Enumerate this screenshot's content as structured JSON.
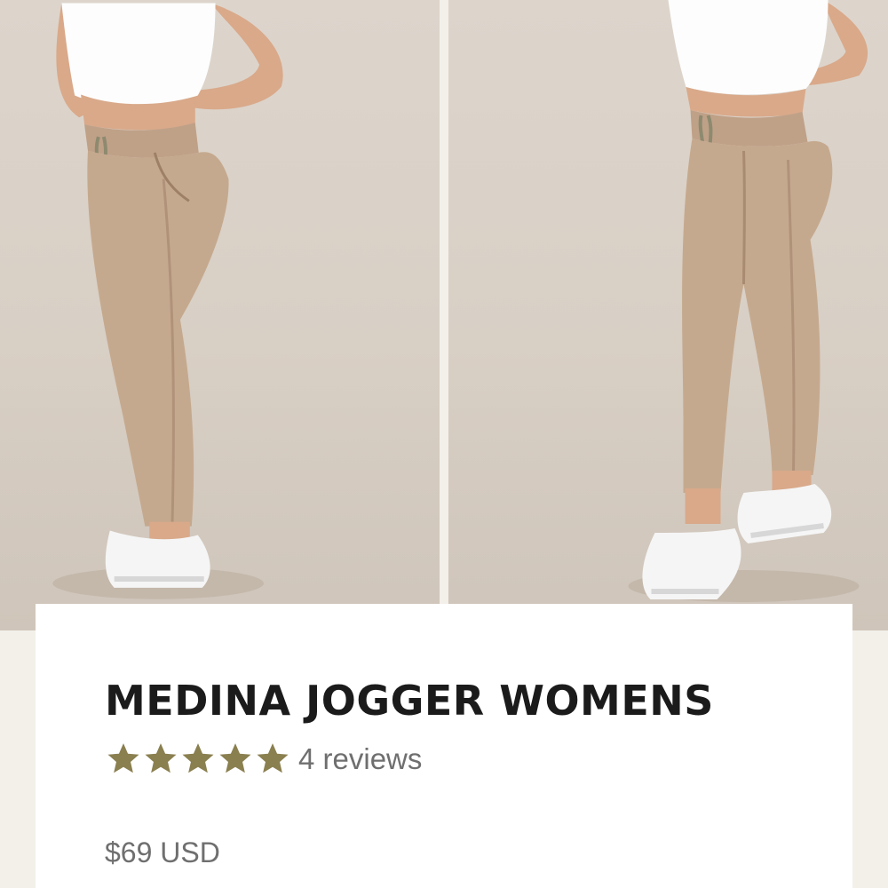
{
  "gallery": {
    "images": [
      {
        "name": "product-photo-front",
        "description_icon": "image"
      },
      {
        "name": "product-photo-side",
        "description_icon": "image"
      }
    ]
  },
  "product": {
    "title": "MEDINA JOGGER WOMENS",
    "rating": {
      "stars": 5,
      "max": 5,
      "reviews_label": "4 reviews"
    },
    "price": "$69 USD"
  },
  "colors": {
    "star": "#8a7f4f",
    "title": "#1b1b1b",
    "muted_text": "#6f6f6f",
    "jogger": "#c5a98e",
    "background": "#f3f0ea"
  }
}
